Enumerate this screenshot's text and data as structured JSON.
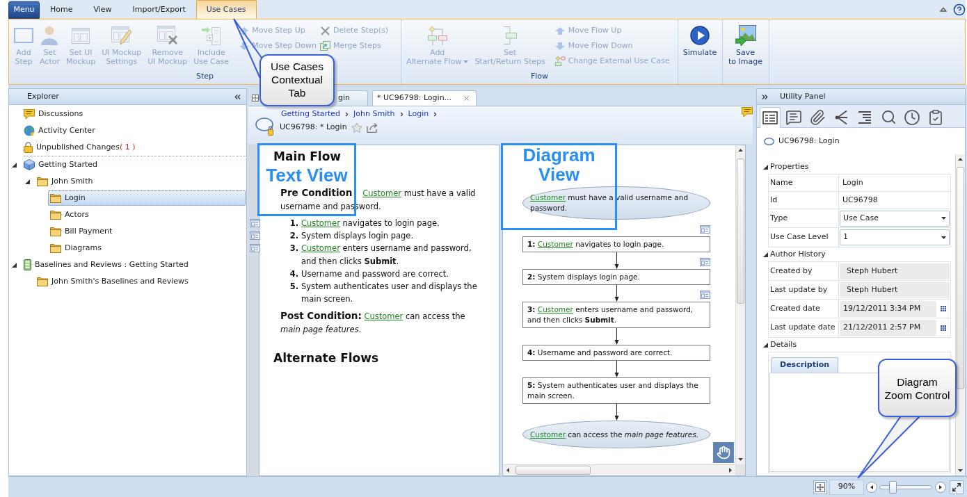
{
  "ribbon": {
    "menu_button": "Menu",
    "tabs": [
      {
        "label": "Home",
        "selected": false
      },
      {
        "label": "View",
        "selected": false
      },
      {
        "label": "Import/Export",
        "selected": false
      },
      {
        "label": "Use Cases",
        "selected": true
      }
    ],
    "groups": [
      {
        "label": "Step",
        "buttons": [
          {
            "label": "Add\nStep",
            "disabled": true
          },
          {
            "label": "Set\nActor",
            "disabled": true
          },
          {
            "label": "Set UI\nMockup",
            "disabled": true
          },
          {
            "label": "UI Mockup\nSettings",
            "disabled": true
          },
          {
            "label": "Remove\nUI Mockup",
            "disabled": true
          },
          {
            "label": "Include\nUse Case",
            "disabled": true
          }
        ],
        "stacks": [
          [
            {
              "label": "Move Step Up",
              "disabled": true
            },
            {
              "label": "Move Step Down",
              "disabled": true
            }
          ],
          [
            {
              "label": "Delete Step(s)",
              "disabled": true
            },
            {
              "label": "Merge Steps",
              "disabled": true
            }
          ]
        ]
      },
      {
        "label": "Flow",
        "buttons": [
          {
            "label": "Add\nAlternate Flow",
            "disabled": true,
            "dropdown": true
          },
          {
            "label": "Set\nStart/Return Steps",
            "disabled": true
          }
        ],
        "stacks": [
          [
            {
              "label": "Move Flow Up",
              "disabled": true
            },
            {
              "label": "Move Flow Down",
              "disabled": true
            },
            {
              "label": "Change External Use Case",
              "disabled": true
            }
          ]
        ]
      },
      {
        "buttons": [
          {
            "label": "Simulate",
            "disabled": false
          }
        ]
      },
      {
        "buttons": [
          {
            "label": "Save\nto Image",
            "disabled": false
          }
        ]
      }
    ]
  },
  "explorer": {
    "title": "Explorer",
    "shortcuts": [
      {
        "label": "Discussions"
      },
      {
        "label": "Activity Center"
      },
      {
        "label": "Unpublished Changes",
        "count": "( 1 )"
      }
    ],
    "tree": [
      {
        "label": "Getting Started",
        "kind": "package",
        "expanded": true,
        "selected": false,
        "children": [
          {
            "label": "John Smith",
            "kind": "folder",
            "expanded": true,
            "selected": false,
            "children": [
              {
                "label": "Login",
                "kind": "folder",
                "selected": true
              },
              {
                "label": "Actors",
                "kind": "folder",
                "selected": false
              },
              {
                "label": "Bill Payment",
                "kind": "folder",
                "selected": false
              },
              {
                "label": "Diagrams",
                "kind": "folder",
                "selected": false
              }
            ]
          }
        ]
      },
      {
        "label": "Baselines and Reviews : Getting Started",
        "kind": "baseline",
        "expanded": true,
        "selected": false,
        "children": [
          {
            "label": "John Smith's Baselines and Reviews",
            "kind": "folder",
            "selected": false
          }
        ]
      }
    ]
  },
  "document": {
    "tabs": [
      {
        "label": "gin",
        "kind": "page",
        "selected": false,
        "closable": false
      },
      {
        "label": "* UC96798: Login...",
        "kind": "editor",
        "selected": true,
        "closable": true
      }
    ],
    "breadcrumb": [
      "Getting Started",
      "John Smith",
      "Login"
    ],
    "title": "UC96798: * Login",
    "text_view": {
      "heading": "Main Flow",
      "pre_condition": {
        "label": "Pre Condition",
        "actor": "Customer",
        "text": "must have a valid username and password."
      },
      "steps": [
        {
          "number": "1.",
          "actor": "Customer",
          "text": "navigates to login page.",
          "mockup": true
        },
        {
          "number": "2.",
          "text": "System displays login page.",
          "mockup": true
        },
        {
          "number": "3.",
          "actor": "Customer",
          "text": "enters username and password, and then clicks **Submit**.",
          "mockup": true
        },
        {
          "number": "4.",
          "text": "Username and password are correct.",
          "mockup": false
        },
        {
          "number": "5.",
          "text": "System authenticates user and displays the main screen.",
          "mockup": false
        }
      ],
      "post_condition": {
        "label": "Post Condition:",
        "actor": "Customer",
        "text": "can access the *main page features*."
      },
      "alternate_heading": "Alternate Flows"
    },
    "diagram": {
      "nodes": [
        {
          "kind": "terminal",
          "actor": "Customer",
          "text": "must have a valid username and password."
        },
        {
          "kind": "step",
          "number": "1:",
          "actor": "Customer",
          "text": "navigates to login page.",
          "mockup": true,
          "arrow_in": false
        },
        {
          "kind": "step",
          "number": "2:",
          "text": "System displays login page.",
          "mockup": true,
          "arrow_in": true
        },
        {
          "kind": "step",
          "number": "3:",
          "actor": "Customer",
          "text": "enters username and password, and then clicks **Submit**.",
          "mockup": true,
          "arrow_in": true
        },
        {
          "kind": "step",
          "number": "4:",
          "text": "Username and password are correct.",
          "mockup": false,
          "arrow_in": true
        },
        {
          "kind": "step",
          "number": "5:",
          "text": "System authenticates user and displays the main screen.",
          "mockup": false,
          "arrow_in": true
        },
        {
          "kind": "terminal",
          "actor": "Customer",
          "text": "can access the *main page features*.",
          "arrow_in": true
        }
      ]
    }
  },
  "utility_panel": {
    "title": "Utility Panel",
    "tool_tabs": [
      {
        "kind": "details",
        "selected": true
      },
      {
        "kind": "comments",
        "selected": false
      },
      {
        "kind": "attachments",
        "selected": false
      },
      {
        "kind": "relations",
        "selected": false
      },
      {
        "kind": "outline",
        "selected": false
      },
      {
        "kind": "search",
        "selected": false
      },
      {
        "kind": "history",
        "selected": false
      },
      {
        "kind": "review",
        "selected": false
      }
    ],
    "item_title": "UC96798: Login",
    "sections": [
      {
        "label": "Properties",
        "expanded": true,
        "rows": [
          {
            "label": "Name",
            "value": "Login",
            "kind": "text"
          },
          {
            "label": "Id",
            "value": "UC96798",
            "kind": "text"
          },
          {
            "label": "Type",
            "value": "Use Case",
            "kind": "select"
          },
          {
            "label": "Use Case Level",
            "value": "1",
            "kind": "select"
          }
        ]
      },
      {
        "label": "Author History",
        "expanded": true,
        "rows": [
          {
            "label": "Created by",
            "value": "Steph Hubert",
            "kind": "readonly"
          },
          {
            "label": "Last update by",
            "value": "Steph Hubert",
            "kind": "readonly"
          },
          {
            "label": "Created date",
            "value": "19/12/2011 3:34 PM",
            "kind": "date"
          },
          {
            "label": "Last update date",
            "value": "21/12/2011 2:57 PM",
            "kind": "date"
          }
        ]
      },
      {
        "label": "Details",
        "expanded": true,
        "tabs": [
          {
            "label": "Description",
            "selected": true
          }
        ]
      }
    ]
  },
  "status_bar": {
    "zoom": "90%",
    "zoom_slider": {
      "level": 0.22
    }
  },
  "annotations": [
    {
      "kind": "callout",
      "text": "Use Cases Contextual Tab"
    },
    {
      "kind": "frame",
      "text": "Text View"
    },
    {
      "kind": "frame",
      "text": "Diagram View"
    },
    {
      "kind": "callout",
      "text": "Diagram Zoom Control"
    }
  ]
}
